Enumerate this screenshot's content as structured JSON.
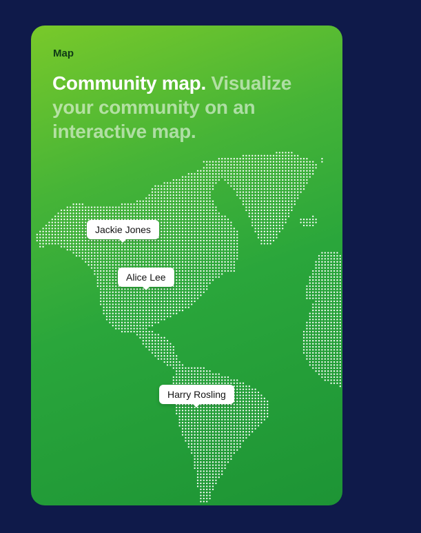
{
  "card": {
    "eyebrow": "Map",
    "headline_strong": "Community map.",
    "headline_muted": "Visualize your community on an interactive map."
  },
  "pins": [
    {
      "label": "Jackie Jones"
    },
    {
      "label": "Alice Lee"
    },
    {
      "label": "Harry Rosling"
    }
  ],
  "colors": {
    "page_background": "#0f1a4a",
    "card_gradient_start": "#79c92a",
    "card_gradient_end": "#1d9435",
    "map_dots": "#ffffff"
  }
}
